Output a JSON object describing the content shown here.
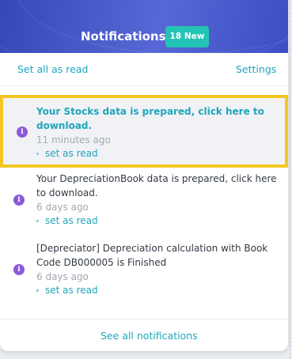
{
  "header": {
    "title": "Notifications",
    "badge": "18 New"
  },
  "toolbar": {
    "mark_all": "Set all as read",
    "settings": "Settings"
  },
  "notifications": [
    {
      "text": "Your Stocks data is prepared, click here to download.",
      "time": "11 minutes ago",
      "action": "set as read"
    },
    {
      "text": "Your DepreciationBook data is prepared, click here to download.",
      "time": "6 days ago",
      "action": "set as read"
    },
    {
      "text": "[Depreciator] Depreciation calculation with Book Code DB000005 is Finished",
      "time": "6 days ago",
      "action": "set as read"
    }
  ],
  "footer": {
    "see_all": "See all notifications"
  },
  "colors": {
    "header": "#3f51c5",
    "badge": "#23c4b5",
    "link": "#1fa6bc",
    "icon": "#8c5ad9",
    "highlight": "#f3c623"
  },
  "icons": {
    "notification": "info-icon"
  }
}
